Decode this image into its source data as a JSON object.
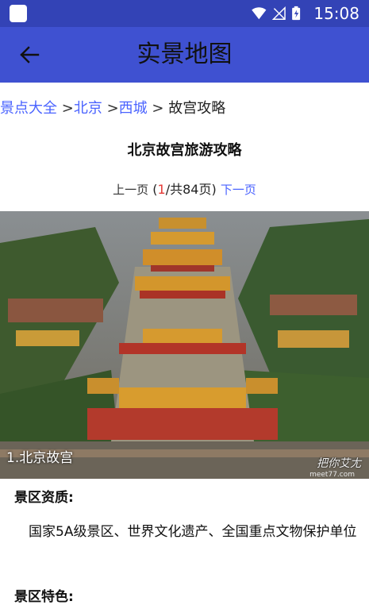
{
  "status_bar": {
    "time": "15:08"
  },
  "app_bar": {
    "title": "实景地图"
  },
  "breadcrumb": {
    "items": [
      "景点大全",
      "北京",
      "西城"
    ],
    "separator": ">",
    "current": "故宫攻略"
  },
  "article": {
    "title": "北京故宫旅游攻略",
    "pager": {
      "prev_label": "上一页",
      "open": "(",
      "current_page": "1",
      "total_text": "/共84页)",
      "next_label": "下一页"
    },
    "image": {
      "caption": "1.北京故宫",
      "watermark": "把你艾尢",
      "watermark_url": "meet77.com"
    },
    "sections": [
      {
        "heading": "景区资质:",
        "text": "国家5A级景区、世界文化遗产、全国重点文物保护单位"
      },
      {
        "heading": "景区特色:"
      }
    ]
  },
  "colors": {
    "status_bar": "#3343b6",
    "app_bar": "#3f51d1",
    "link": "#4a63ff",
    "page_number": "#e53935"
  }
}
